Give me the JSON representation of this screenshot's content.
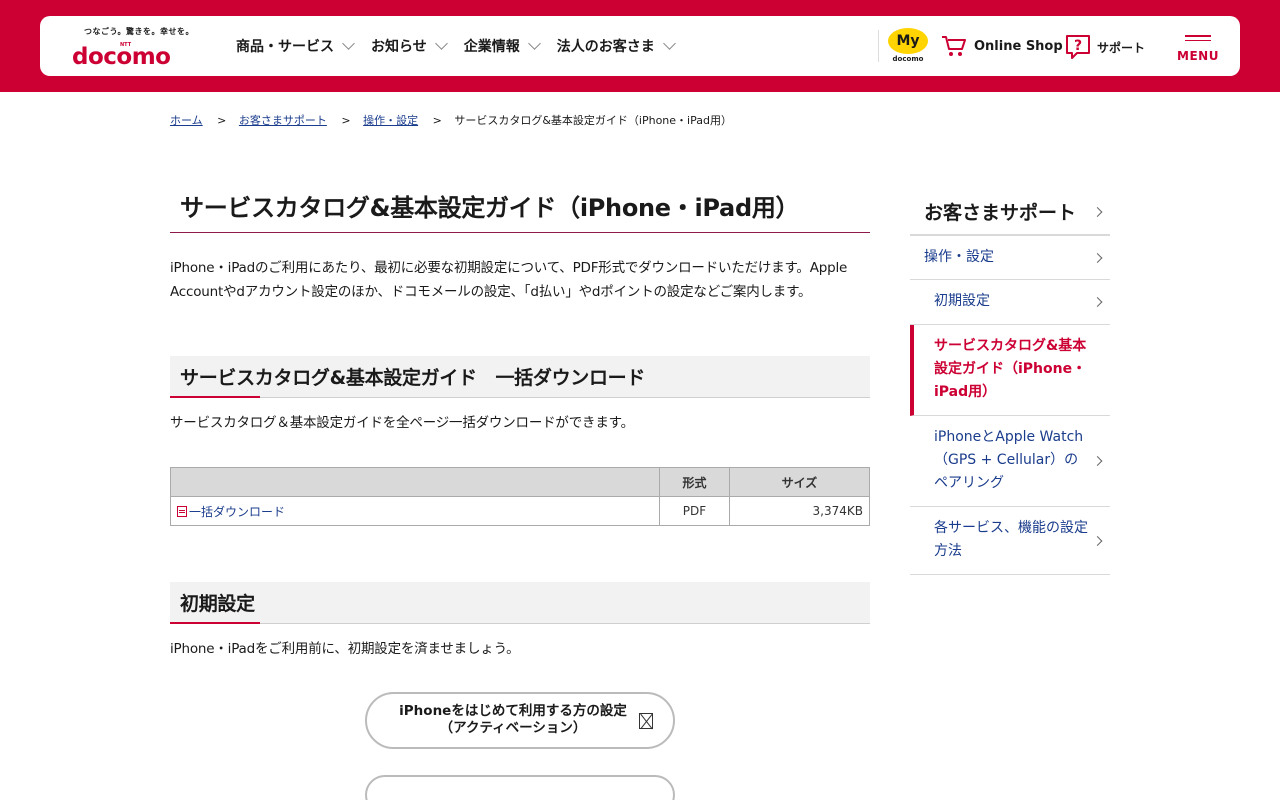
{
  "header": {
    "logo_tagline": "つなごう。驚きを。幸せを。",
    "logo_ntt": "NTT",
    "logo_word": "docomo",
    "nav": [
      {
        "label": "商品・サービス"
      },
      {
        "label": "お知らせ"
      },
      {
        "label": "企業情報"
      },
      {
        "label": "法人のお客さま"
      }
    ],
    "my_label": "My",
    "my_sub": "docomo",
    "online_shop": "Online Shop",
    "support": "サポート",
    "menu": "MENU"
  },
  "breadcrumb": {
    "items": [
      {
        "label": "ホーム"
      },
      {
        "label": "お客さまサポート"
      },
      {
        "label": "操作・設定"
      }
    ],
    "current": "サービスカタログ&基本設定ガイド（iPhone・iPad用）",
    "separator": ">"
  },
  "page": {
    "title": "サービスカタログ&基本設定ガイド（iPhone・iPad用）",
    "intro": "iPhone・iPadのご利用にあたり、最初に必要な初期設定について、PDF形式でダウンロードいただけます。Apple Accountやdアカウント設定のほか、ドコモメールの設定、「d払い」やdポイントの設定などご案内します。"
  },
  "section_download": {
    "heading": "サービスカタログ&基本設定ガイド　一括ダウンロード",
    "description": "サービスカタログ＆基本設定ガイドを全ページ一括ダウンロードができます。",
    "table": {
      "headers": [
        "",
        "形式",
        "サイズ"
      ],
      "rows": [
        {
          "name": "一括ダウンロード",
          "format": "PDF",
          "size": "3,374KB"
        }
      ]
    }
  },
  "section_initial": {
    "heading": "初期設定",
    "description": "iPhone・iPadをご利用前に、初期設定を済ませましょう。",
    "button_line1": "iPhoneをはじめて利用する方の設定",
    "button_line2": "（アクティベーション）"
  },
  "sidenav": {
    "items": [
      {
        "label": "お客さまサポート"
      },
      {
        "label": "操作・設定"
      },
      {
        "label": "初期設定"
      },
      {
        "label": "サービスカタログ&基本設定ガイド（iPhone・iPad用）"
      },
      {
        "label": "iPhoneとApple Watch（GPS + Cellular）のペアリング"
      },
      {
        "label": "各サービス、機能の設定方法"
      }
    ]
  },
  "colors": {
    "brand": "#cc0033",
    "link": "#1a3c8c",
    "my_docomo_badge": "#ffd400"
  }
}
